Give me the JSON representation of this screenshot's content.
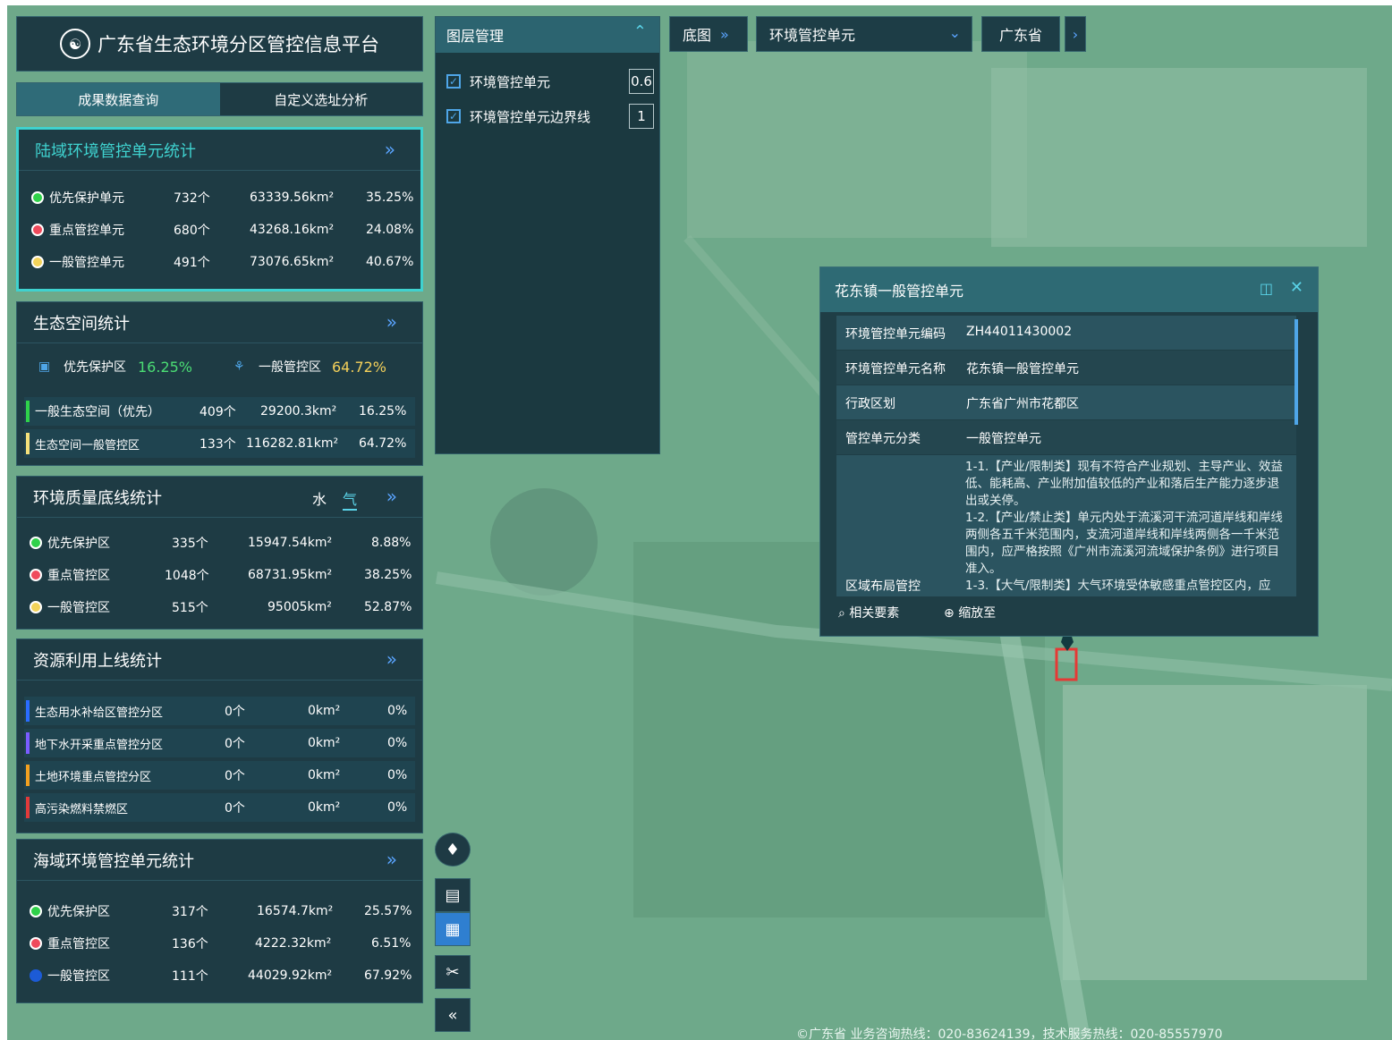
{
  "app": {
    "title": "广东省生态环境分区管控信息平台",
    "logo_icon": "emblem-icon"
  },
  "tabs": [
    {
      "label": "成果数据查询",
      "active": true
    },
    {
      "label": "自定义选址分析",
      "active": false
    }
  ],
  "land": {
    "title": "陆域环境管控单元统计",
    "rows": [
      {
        "name": "优先保护单元",
        "count": "732个",
        "area": "63339.56km²",
        "pct": "35.25%",
        "color": "#2fd14a"
      },
      {
        "name": "重点管控单元",
        "count": "680个",
        "area": "43268.16km²",
        "pct": "24.08%",
        "color": "#ef4a5c"
      },
      {
        "name": "一般管控单元",
        "count": "491个",
        "area": "73076.65km²",
        "pct": "40.67%",
        "color": "#f3d35a"
      }
    ]
  },
  "eco": {
    "title": "生态空间统计",
    "summary": [
      {
        "label": "优先保护区",
        "value": "16.25%",
        "color": "#4bdd74",
        "icon": "shield-map-icon"
      },
      {
        "label": "一般管控区",
        "value": "64.72%",
        "color": "#f4d05a",
        "icon": "nodes-icon"
      }
    ],
    "rows": [
      {
        "name": "一般生态空间（优先）",
        "count": "409个",
        "area": "29200.3km²",
        "pct": "16.25%",
        "color": "#2fd14a"
      },
      {
        "name": "生态空间一般管控区",
        "count": "133个",
        "area": "116282.81km²",
        "pct": "64.72%",
        "color": "#f4e07a"
      }
    ]
  },
  "env": {
    "title": "环境质量底线统计",
    "tab_water": "水",
    "tab_air": "气",
    "rows": [
      {
        "name": "优先保护区",
        "count": "335个",
        "area": "15947.54km²",
        "pct": "8.88%",
        "color": "#2fd14a"
      },
      {
        "name": "重点管控区",
        "count": "1048个",
        "area": "68731.95km²",
        "pct": "38.25%",
        "color": "#ef4a5c"
      },
      {
        "name": "一般管控区",
        "count": "515个",
        "area": "95005km²",
        "pct": "52.87%",
        "color": "#f3d35a"
      }
    ]
  },
  "res": {
    "title": "资源利用上线统计",
    "rows": [
      {
        "name": "生态用水补给区管控分区",
        "count": "0个",
        "area": "0km²",
        "pct": "0%",
        "color": "#2a6cff"
      },
      {
        "name": "地下水开采重点管控分区",
        "count": "0个",
        "area": "0km²",
        "pct": "0%",
        "color": "#7a5cff"
      },
      {
        "name": "土地环境重点管控分区",
        "count": "0个",
        "area": "0km²",
        "pct": "0%",
        "color": "#f2a020"
      },
      {
        "name": "高污染燃料禁燃区",
        "count": "0个",
        "area": "0km²",
        "pct": "0%",
        "color": "#e03a3a"
      }
    ]
  },
  "sea": {
    "title": "海域环境管控单元统计",
    "rows": [
      {
        "name": "优先保护区",
        "count": "317个",
        "area": "16574.7km²",
        "pct": "25.57%",
        "color": "#2fd14a"
      },
      {
        "name": "重点管控区",
        "count": "136个",
        "area": "4222.32km²",
        "pct": "6.51%",
        "color": "#ef4a5c"
      },
      {
        "name": "一般管控区",
        "count": "111个",
        "area": "44029.92km²",
        "pct": "67.92%",
        "color": "#1c5bd6"
      }
    ]
  },
  "layers": {
    "title": "图层管理",
    "items": [
      {
        "label": "环境管控单元",
        "value": "0.6",
        "checked": true
      },
      {
        "label": "环境管控单元边界线",
        "value": "1",
        "checked": true
      }
    ]
  },
  "toolbar": {
    "basemap": "底图",
    "dropdown": "环境管控单元",
    "region": "广东省"
  },
  "popup": {
    "title": "花东镇一般管控单元",
    "rows": [
      {
        "k": "环境管控单元编码",
        "v": "ZH44011430002"
      },
      {
        "k": "环境管控单元名称",
        "v": "花东镇一般管控单元"
      },
      {
        "k": "行政区划",
        "v": "广东省广州市花都区"
      },
      {
        "k": "管控单元分类",
        "v": "一般管控单元"
      }
    ],
    "layout_label": "区域布局管控",
    "layout_text": "1-1.【产业/限制类】现有不符合产业规划、主导产业、效益低、能耗高、产业附加值较低的产业和落后生产能力逐步退出或关停。\n1-2.【产业/禁止类】单元内处于流溪河干流河道岸线和岸线两侧各五千米范围内，支流河道岸线和岸线两侧各一千米范围内，应严格按照《广州市流溪河流域保护条例》进行项目准入。\n1-3.【大气/限制类】大气环境受体敏感重点管控区内，应",
    "btn_related": "相关要素",
    "btn_zoom": "缩放至"
  },
  "footer": "©广东省    业务咨询热线：020-83624139，技术服务热线：020-85557970"
}
